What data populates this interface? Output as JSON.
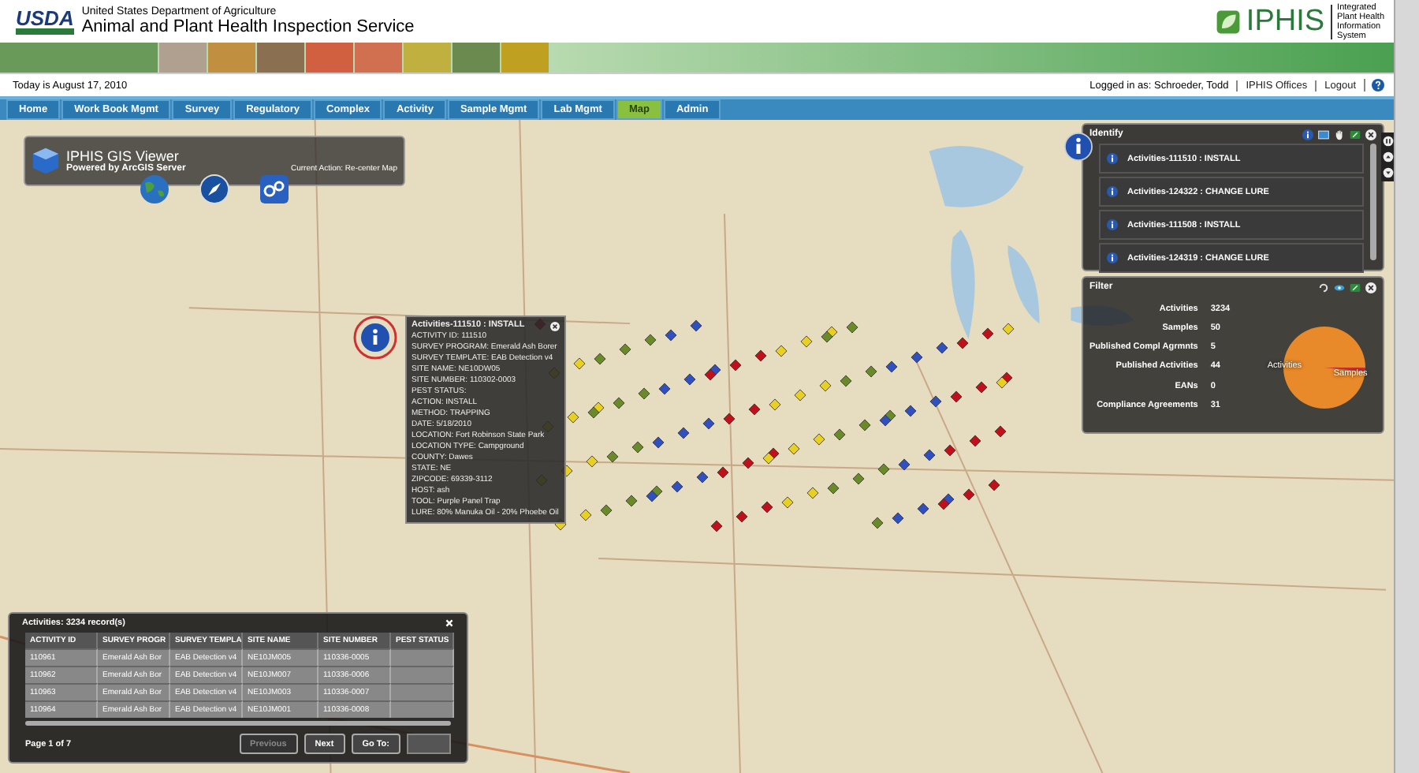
{
  "header": {
    "logo": "USDA",
    "department": "United States Department of Agriculture",
    "agency": "Animal and Plant Health Inspection Service",
    "app_logo": "IPHIS",
    "app_subtitle_lines": [
      "Integrated",
      "Plant Health",
      "Information",
      "System"
    ]
  },
  "info_bar": {
    "date": "Today is August 17, 2010",
    "user": "Logged in as: Schroeder, Todd",
    "links": [
      "IPHIS Offices",
      "Logout"
    ]
  },
  "nav": [
    {
      "label": "Home",
      "selected": false
    },
    {
      "label": "Work Book Mgmt",
      "selected": false
    },
    {
      "label": "Survey",
      "selected": false
    },
    {
      "label": "Regulatory",
      "selected": false
    },
    {
      "label": "Complex",
      "selected": false
    },
    {
      "label": "Activity",
      "selected": false
    },
    {
      "label": "Sample Mgmt",
      "selected": false
    },
    {
      "label": "Lab Mgmt",
      "selected": false
    },
    {
      "label": "Map",
      "selected": true
    },
    {
      "label": "Admin",
      "selected": false
    }
  ],
  "gis_panel": {
    "title": "IPHIS GIS Viewer",
    "subtitle": "Powered by ArcGIS Server",
    "action": "Current Action: Re-center Map"
  },
  "popup": {
    "title": "Activities-111510 : INSTALL",
    "lines": [
      "ACTIVITY ID: 111510",
      "SURVEY PROGRAM: Emerald Ash Borer",
      "SURVEY TEMPLATE: EAB Detection v4",
      "SITE NAME: NE10DW05",
      "SITE NUMBER: 110302-0003",
      "PEST STATUS:",
      "ACTION: INSTALL",
      "METHOD: TRAPPING",
      "DATE: 5/18/2010",
      "LOCATION: Fort Robinson State Park",
      "LOCATION TYPE: Campground",
      "COUNTY: Dawes",
      "STATE: NE",
      "ZIPCODE: 69339-3112",
      "HOST: ash",
      "TOOL: Purple Panel Trap",
      "LURE: 80% Manuka Oil - 20% Phoebe Oil"
    ]
  },
  "identify": {
    "title": "Identify",
    "items": [
      "Activities-111510 : INSTALL",
      "Activities-124322 : CHANGE LURE",
      "Activities-111508 : INSTALL",
      "Activities-124319 : CHANGE LURE"
    ]
  },
  "filter": {
    "title": "Filter",
    "stats": [
      {
        "label": "Activities",
        "value": "3234"
      },
      {
        "label": "Samples",
        "value": "50"
      },
      {
        "label": "Published Compl Agrmnts",
        "value": "5"
      },
      {
        "label": "Published Activities",
        "value": "44"
      },
      {
        "label": "EANs",
        "value": "0"
      },
      {
        "label": "Compliance Agreements",
        "value": "31"
      }
    ],
    "pie_labels": [
      "Activities",
      "Samples"
    ]
  },
  "table": {
    "title": "Activities: 3234 record(s)",
    "columns": [
      "ACTIVITY ID",
      "SURVEY PROGR",
      "SURVEY TEMPLA",
      "SITE NAME",
      "SITE NUMBER",
      "PEST STATUS"
    ],
    "rows": [
      [
        "110961",
        "Emerald Ash Bor",
        "EAB Detection v4",
        "NE10JM005",
        "110336-0005"
      ],
      [
        "110962",
        "Emerald Ash Bor",
        "EAB Detection v4",
        "NE10JM007",
        "110336-0006"
      ],
      [
        "110963",
        "Emerald Ash Bor",
        "EAB Detection v4",
        "NE10JM003",
        "110336-0007"
      ],
      [
        "110964",
        "Emerald Ash Bor",
        "EAB Detection v4",
        "NE10JM001",
        "110336-0008"
      ]
    ],
    "page": "Page 1 of 7",
    "buttons": [
      {
        "label": "Previous",
        "disabled": true
      },
      {
        "label": "Next",
        "disabled": false
      },
      {
        "label": "Go To:",
        "disabled": false
      }
    ]
  }
}
